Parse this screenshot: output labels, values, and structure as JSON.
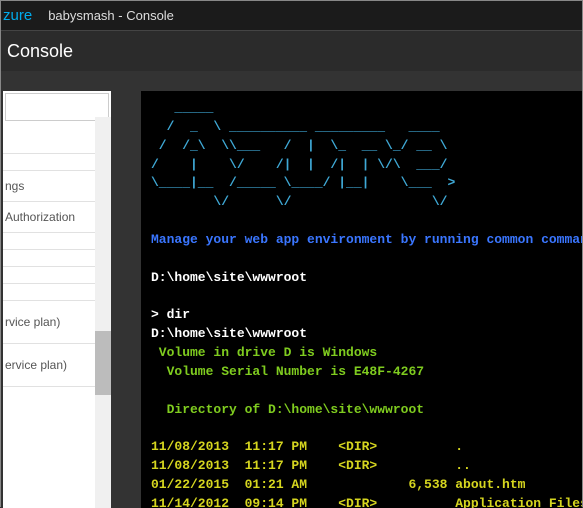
{
  "header": {
    "brand": "zure",
    "breadcrumb": "babysmash - Console"
  },
  "subheader": {
    "title": "Console"
  },
  "sidebar": {
    "items": [
      {
        "label": "ngs"
      },
      {
        "label": "Authorization"
      },
      {
        "label": "rvice plan)"
      },
      {
        "label": "ervice plan)"
      }
    ]
  },
  "terminal": {
    "ascii": [
      "   _____                         ",
      "  /  _  \\ __________ _________   ____  ",
      " /  /_\\  \\\\___   /  |  \\_  __ \\_/ __ \\ ",
      "/    |    \\/    /|  |  /|  | \\/\\  ___/ ",
      "\\____|__  /_____ \\____/ |__|    \\___  >",
      "        \\/      \\/                  \\/ "
    ],
    "help": "Manage your web app environment by running common commands ('mkdir",
    "cwd": "D:\\home\\site\\wwwroot",
    "prompt": "> dir",
    "echo_cwd": "D:\\home\\site\\wwwroot",
    "vol1": " Volume in drive D is Windows",
    "vol2": "  Volume Serial Number is E48F-4267",
    "dirof": "  Directory of D:\\home\\site\\wwwroot",
    "rows": [
      "11/08/2013  11:17 PM    <DIR>          .",
      "11/08/2013  11:17 PM    <DIR>          ..",
      "01/22/2015  01:21 AM             6,538 about.htm",
      "11/14/2012  09:14 PM    <DIR>          Application Files"
    ]
  }
}
